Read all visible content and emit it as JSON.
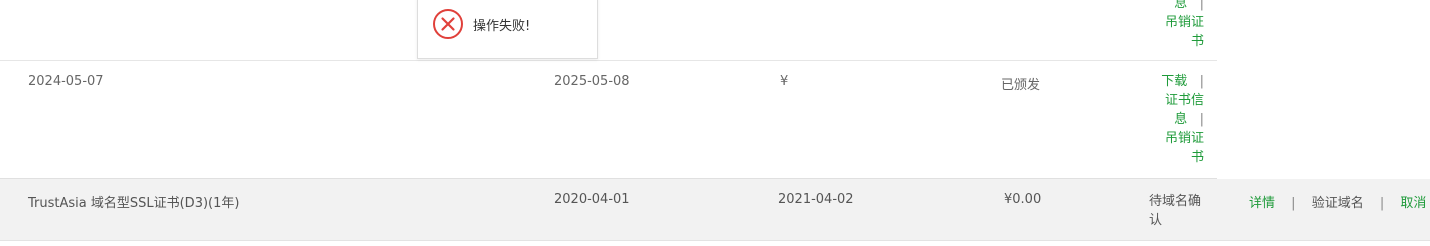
{
  "toast": {
    "icon": "error-circle-x-icon",
    "message": "操作失败!"
  },
  "rows": [
    {
      "ops": {
        "info_tail": "息",
        "sep": "|",
        "revoke_line1": "吊销证",
        "revoke_line2": "书"
      }
    },
    {
      "start_date": "2024-05-07",
      "end_date": "2025-05-08",
      "price": "¥",
      "status": "已颁发",
      "ops": {
        "download": "下载",
        "sep": "|",
        "info_line1": "证书信",
        "info_line2": "息",
        "revoke_line1": "吊销证",
        "revoke_line2": "书"
      }
    },
    {
      "product": "TrustAsia 域名型SSL证书(D3)(1年)",
      "start_date": "2020-04-01",
      "end_date": "2021-04-02",
      "price": "¥0.00",
      "status_line1": "待域名确",
      "status_line2": "认",
      "ops": {
        "detail": "详情",
        "verify": "验证域名",
        "cancel": "取消",
        "sep": "|"
      }
    }
  ],
  "colors": {
    "action_link": "#1f9b3a",
    "error": "#e0403a",
    "row_highlight": "#f2f2f2"
  }
}
